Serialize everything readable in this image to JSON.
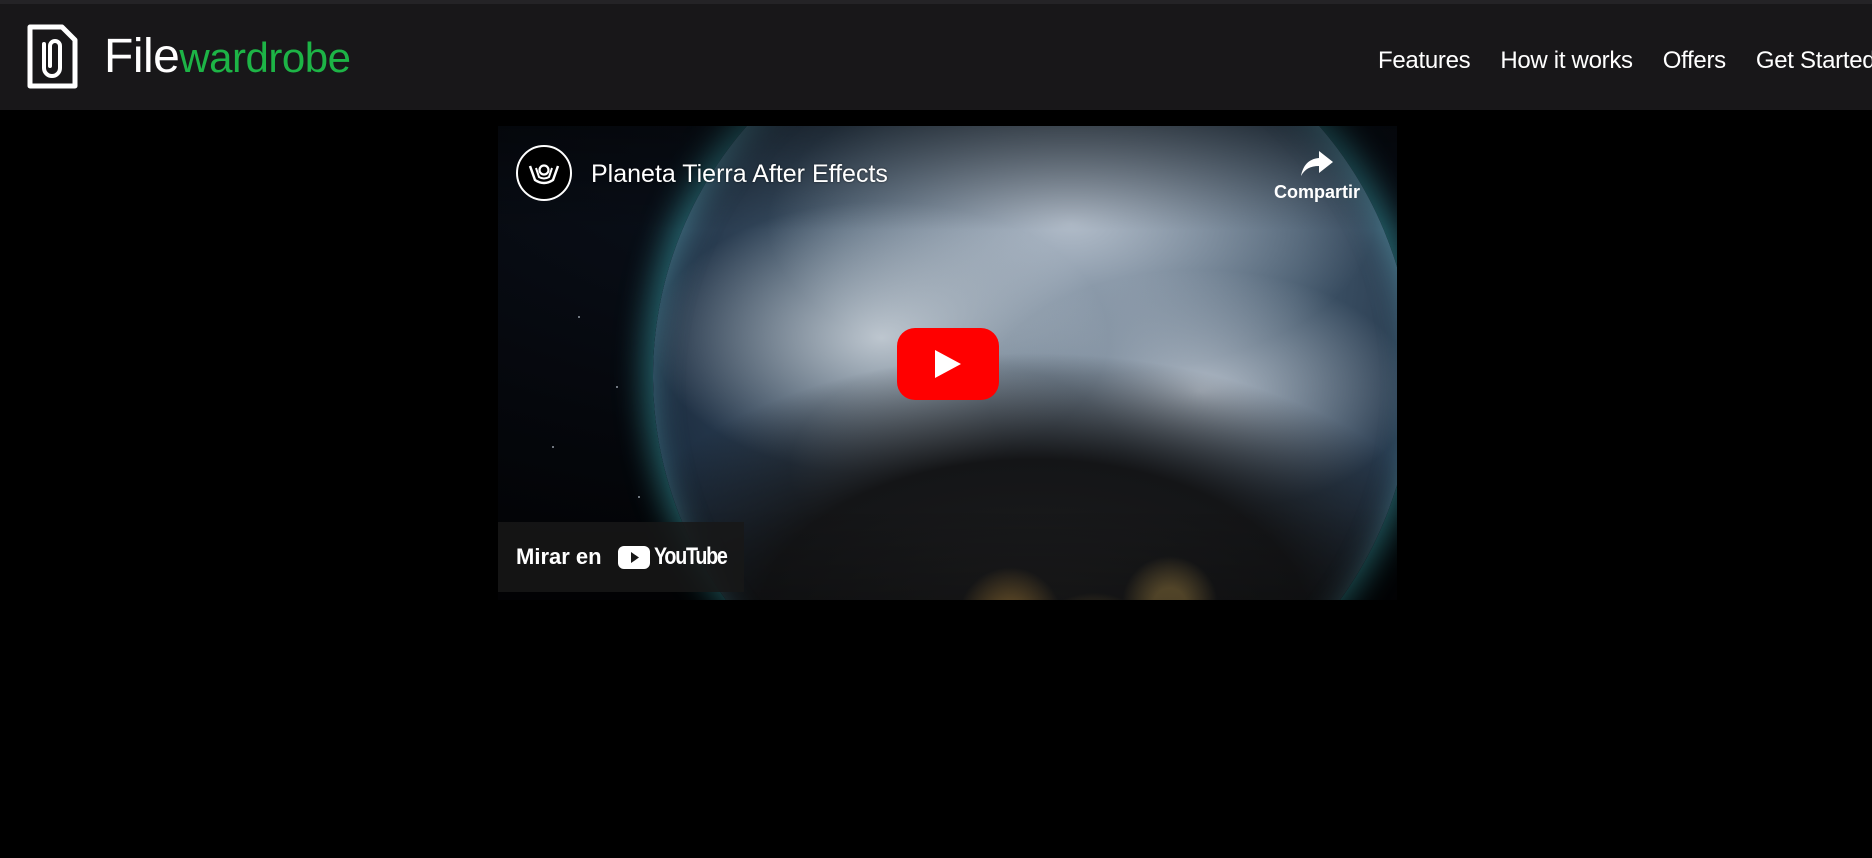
{
  "header": {
    "brand_part1": "File",
    "brand_part2": "wardrobe",
    "brand_color_accent": "#1db446",
    "logo_icon": "paperclip-file-icon",
    "nav": [
      {
        "label": "Features"
      },
      {
        "label": "How it works"
      },
      {
        "label": "Offers"
      },
      {
        "label": "Get Started"
      }
    ]
  },
  "video": {
    "title": "Planeta Tierra After Effects",
    "channel_icon": "channel-avatar-icon",
    "share_label": "Compartir",
    "share_icon": "share-arrow-icon",
    "play_icon": "play-icon",
    "play_color": "#ff0000",
    "watch_on_label": "Mirar en",
    "youtube_word": "YouTube"
  }
}
